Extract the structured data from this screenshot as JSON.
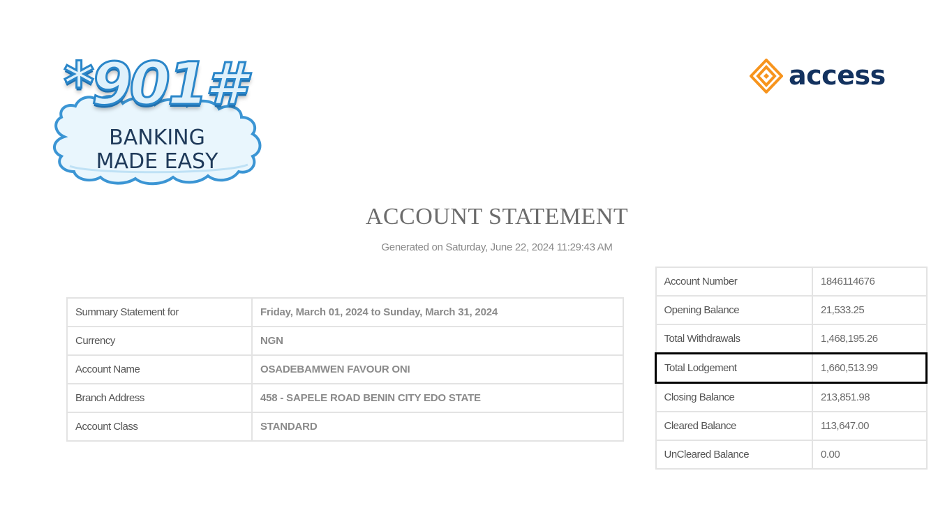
{
  "logos": {
    "badge_code": "*901#",
    "badge_line1": "BANKING",
    "badge_line2": "MADE EASY",
    "bank_name": "access",
    "colors": {
      "badge_blue": "#2a86c9",
      "access_navy": "#13325f",
      "access_orange": "#f7941d"
    }
  },
  "header": {
    "title": "ACCOUNT STATEMENT",
    "generated": "Generated on Saturday, June 22, 2024 11:29:43 AM"
  },
  "summary": [
    {
      "label": "Summary Statement for",
      "value": "Friday, March 01, 2024 to  Sunday, March 31,  2024"
    },
    {
      "label": "Currency",
      "value": "NGN"
    },
    {
      "label": "Account Name",
      "value": "OSADEBAMWEN FAVOUR ONI"
    },
    {
      "label": "Branch Address",
      "value": "458 - SAPELE ROAD BENIN CITY EDO STATE"
    },
    {
      "label": "Account Class",
      "value": "STANDARD"
    }
  ],
  "balances": [
    {
      "label": "Account Number",
      "value": "1846114676"
    },
    {
      "label": "Opening Balance",
      "value": "21,533.25"
    },
    {
      "label": "Total Withdrawals",
      "value": "1,468,195.26"
    },
    {
      "label": "Total Lodgement",
      "value": "1,660,513.99"
    },
    {
      "label": "Closing Balance",
      "value": "213,851.98"
    },
    {
      "label": "Cleared Balance",
      "value": "113,647.00"
    },
    {
      "label": "UnCleared Balance",
      "value": "0.00"
    }
  ]
}
